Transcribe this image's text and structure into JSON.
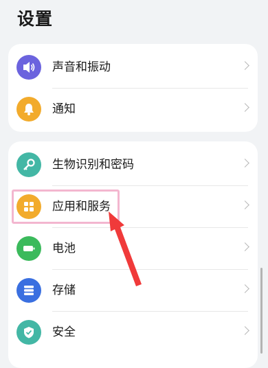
{
  "header": {
    "title": "设置"
  },
  "groups": [
    {
      "items": [
        {
          "label": "声音和振动",
          "icon": "speaker-icon",
          "color": "#6b63de"
        },
        {
          "label": "通知",
          "icon": "bell-icon",
          "color": "#f2ab2c"
        }
      ]
    },
    {
      "items": [
        {
          "label": "生物识别和密码",
          "icon": "key-icon",
          "color": "#43b7a5"
        },
        {
          "label": "应用和服务",
          "icon": "apps-grid-icon",
          "color": "#f2ab2c"
        },
        {
          "label": "电池",
          "icon": "battery-icon",
          "color": "#3bba5c"
        },
        {
          "label": "存储",
          "icon": "storage-icon",
          "color": "#3a6fe0"
        },
        {
          "label": "安全",
          "icon": "shield-icon",
          "color": "#43b7a5"
        }
      ]
    }
  ],
  "annotation": {
    "highlight_color": "#f3b6cf",
    "arrow_color": "#f03a3a",
    "target": "应用和服务"
  }
}
